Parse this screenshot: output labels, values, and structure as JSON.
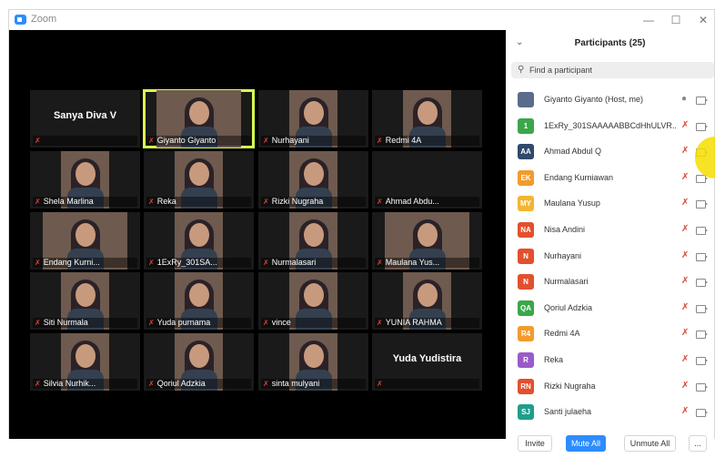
{
  "window": {
    "title": "Zoom"
  },
  "gallery": {
    "tiles": [
      {
        "name": "Sanya Diva V",
        "video": false
      },
      {
        "name": "Giyanto Giyanto",
        "video": true,
        "active": true
      },
      {
        "name": "Nurhayani",
        "video": true
      },
      {
        "name": "Redmi 4A",
        "video": true
      },
      {
        "name": "Shela Marlina",
        "video": true
      },
      {
        "name": "Reka",
        "video": true
      },
      {
        "name": "Rizki Nugraha",
        "video": true
      },
      {
        "name": "Ahmad Abdu...",
        "video": false
      },
      {
        "name": "Endang Kurni...",
        "video": true
      },
      {
        "name": "1ExRy_301SA...",
        "video": true
      },
      {
        "name": "Nurmalasari",
        "video": true
      },
      {
        "name": "Maulana Yus...",
        "video": true
      },
      {
        "name": "Siti Nurmala",
        "video": true
      },
      {
        "name": "Yuda purnama",
        "video": true
      },
      {
        "name": "vince",
        "video": true
      },
      {
        "name": "YUNIA RAHMA",
        "video": true
      },
      {
        "name": "Silvia Nurhik...",
        "video": true
      },
      {
        "name": "Qoriul Adzkia",
        "video": true
      },
      {
        "name": "sinta mulyani",
        "video": true
      },
      {
        "name": "Yuda Yudistira",
        "video": false
      }
    ]
  },
  "participants": {
    "title": "Participants (25)",
    "search_placeholder": "Find a participant",
    "list": [
      {
        "initials": "",
        "color": "#5b6b8c",
        "name": "Giyanto Giyanto (Host, me)",
        "mic": "on",
        "photo": true
      },
      {
        "initials": "1",
        "color": "#3aa74a",
        "name": "1ExRy_301SAAAAABBCdHhULVR...",
        "mic": "muted"
      },
      {
        "initials": "AA",
        "color": "#2f4a6b",
        "name": "Ahmad Abdul Q",
        "mic": "muted"
      },
      {
        "initials": "EK",
        "color": "#f29b2e",
        "name": "Endang Kurniawan",
        "mic": "muted"
      },
      {
        "initials": "MY",
        "color": "#f2b633",
        "name": "Maulana Yusup",
        "mic": "muted"
      },
      {
        "initials": "NA",
        "color": "#e2502d",
        "name": "Nisa Andini",
        "mic": "muted"
      },
      {
        "initials": "N",
        "color": "#e2502d",
        "name": "Nurhayani",
        "mic": "muted"
      },
      {
        "initials": "N",
        "color": "#e2502d",
        "name": "Nurmalasari",
        "mic": "muted"
      },
      {
        "initials": "QA",
        "color": "#3aa74a",
        "name": "Qoriul Adzkia",
        "mic": "muted"
      },
      {
        "initials": "R4",
        "color": "#f29b2e",
        "name": "Redmi 4A",
        "mic": "muted"
      },
      {
        "initials": "R",
        "color": "#9a5bc9",
        "name": "Reka",
        "mic": "muted"
      },
      {
        "initials": "RN",
        "color": "#e2502d",
        "name": "Rizki Nugraha",
        "mic": "muted"
      },
      {
        "initials": "SJ",
        "color": "#1f9e8a",
        "name": "Santi julaeha",
        "mic": "muted"
      }
    ]
  },
  "footer": {
    "invite": "Invite",
    "mute_all": "Mute All",
    "unmute_all": "Unmute All",
    "more": "..."
  },
  "colors": {
    "accent": "#2d8cff",
    "active_speaker": "#d9ff4f",
    "muted": "#d9463b"
  }
}
